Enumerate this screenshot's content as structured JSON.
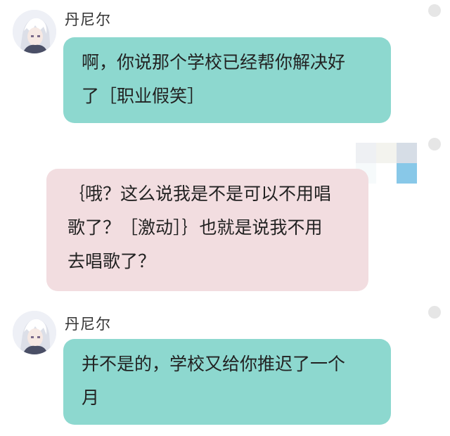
{
  "chat": {
    "messages": [
      {
        "sender": "丹尼尔",
        "lines": [
          "啊，你说那个学校已经帮你解决好",
          "了［职业假笑］"
        ]
      },
      {
        "lines": [
          "｛哦？这么说我是不是可以不用唱",
          "歌了？［激动］｝也就是说我不用",
          "去唱歌了？"
        ]
      },
      {
        "sender": "丹尼尔",
        "lines": [
          "并不是的，学校又给你推迟了一个",
          "月"
        ]
      }
    ]
  },
  "colors": {
    "incoming_bubble": "#8dd8cf",
    "outgoing_bubble": "#f2dde0",
    "status_dot": "#e6e6e6"
  }
}
